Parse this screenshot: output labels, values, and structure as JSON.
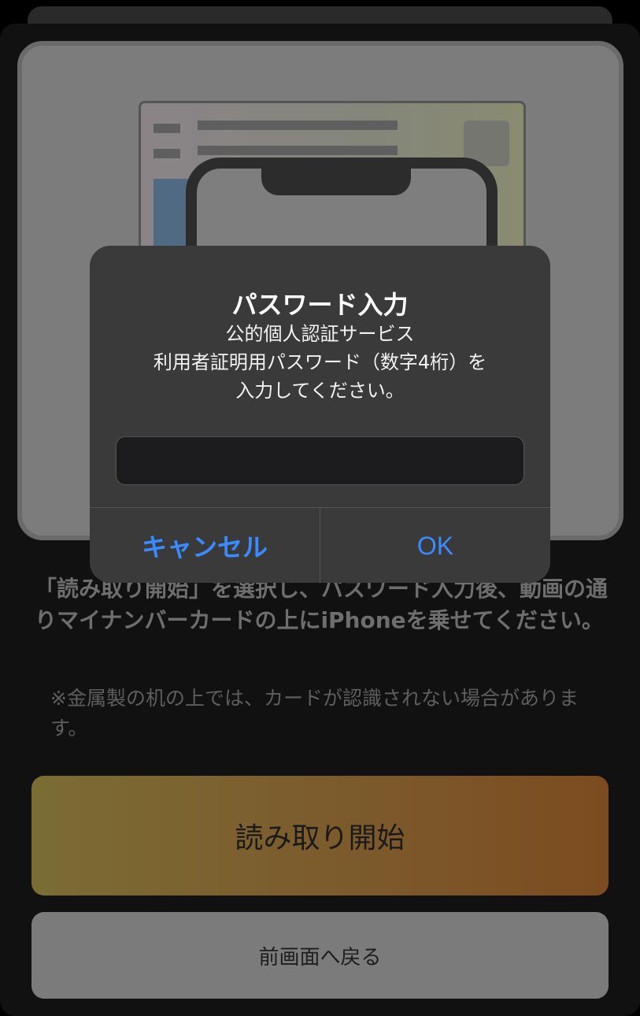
{
  "instructions": "「読み取り開始」を選択し、パスワード入力後、動画の通りマイナンバーカードの上にiPhoneを乗せてください。",
  "note": "※金属製の机の上では、カードが認識されない場合があります。",
  "start_button": "読み取り開始",
  "back_button": "前画面へ戻る",
  "alert": {
    "title": "パスワード入力",
    "message_lines": [
      "公的個人認証サービス",
      "利用者証明用パスワード（数字4桁）を",
      "入力してください。"
    ],
    "input_value": "",
    "input_placeholder": "",
    "cancel_label": "キャンセル",
    "ok_label": "OK"
  },
  "colors": {
    "accent": "#3a8bff",
    "start_gradient_left": "#7b6c34",
    "start_gradient_right": "#7c4c20"
  }
}
